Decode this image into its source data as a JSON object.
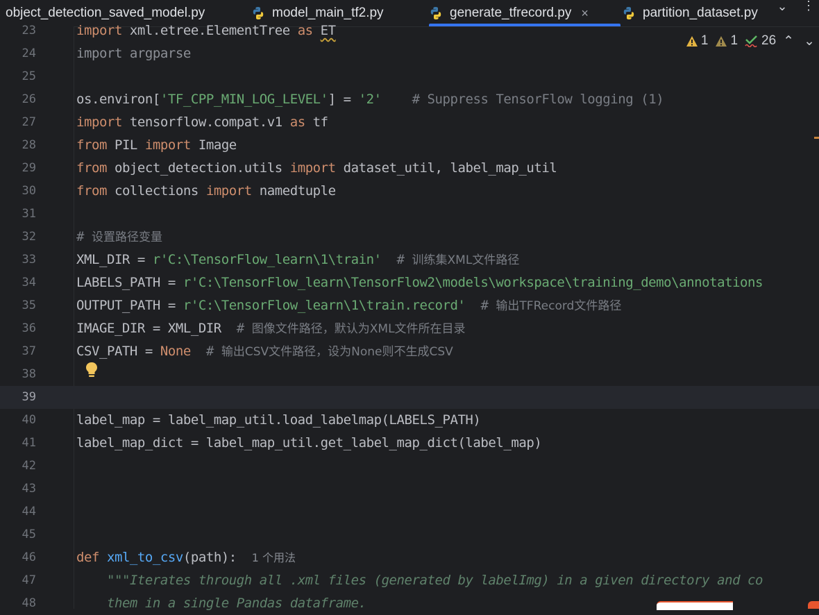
{
  "tabs": [
    {
      "label": "object_detection_saved_model.py",
      "icon": "python-file-icon",
      "active": false
    },
    {
      "label": "model_main_tf2.py",
      "icon": "python-file-icon",
      "active": false
    },
    {
      "label": "generate_tfrecord.py",
      "icon": "python-file-icon",
      "active": true
    },
    {
      "label": "partition_dataset.py",
      "icon": "python-file-icon",
      "active": false
    }
  ],
  "tab_close_glyph": "×",
  "tab_overflow_glyph": "⌄",
  "more_glyph": "⋮",
  "inspections": {
    "warnings": "1",
    "weak_warnings": "1",
    "typos": "26",
    "up_glyph": "⌃",
    "down_glyph": "⌄"
  },
  "current_line": "39",
  "editor": {
    "l23": {
      "n": "23",
      "t": [
        "import",
        " xml.etree.ElementTree ",
        "as",
        " ",
        "ET"
      ]
    },
    "l24": {
      "n": "24",
      "t": [
        "import argparse"
      ]
    },
    "l25": {
      "n": "25"
    },
    "l26": {
      "n": "26",
      "t": [
        "os.environ[",
        "'TF_CPP_MIN_LOG_LEVEL'",
        "] = ",
        "'2'",
        "    ",
        "# Suppress TensorFlow logging (1)"
      ]
    },
    "l27": {
      "n": "27",
      "t": [
        "import",
        " tensorflow.compat.v1 ",
        "as",
        " tf"
      ]
    },
    "l28": {
      "n": "28",
      "t": [
        "from",
        " PIL ",
        "import",
        " Image"
      ]
    },
    "l29": {
      "n": "29",
      "t": [
        "from",
        " object_detection.utils ",
        "import",
        " dataset_util, label_map_util"
      ]
    },
    "l30": {
      "n": "30",
      "t": [
        "from",
        " collections ",
        "import",
        " namedtuple"
      ]
    },
    "l31": {
      "n": "31"
    },
    "l32": {
      "n": "32",
      "t": [
        "# ",
        "设置路径变量"
      ]
    },
    "l33": {
      "n": "33",
      "t": [
        "XML_DIR = ",
        "r'C:\\TensorFlow_learn\\1\\train'",
        "  ",
        "# ",
        "训练集XML文件路径"
      ]
    },
    "l34": {
      "n": "34",
      "t": [
        "LABELS_PATH = ",
        "r'C:\\TensorFlow_learn\\TensorFlow2\\models\\workspace\\training_demo\\annotations"
      ]
    },
    "l35": {
      "n": "35",
      "t": [
        "OUTPUT_PATH = ",
        "r'C:\\TensorFlow_learn\\1\\train.record'",
        "  ",
        "# ",
        "输出TFRecord文件路径"
      ]
    },
    "l36": {
      "n": "36",
      "t": [
        "IMAGE_DIR = XML_DIR  ",
        "# ",
        "图像文件路径，默认为XML文件所在目录"
      ]
    },
    "l37": {
      "n": "37",
      "t": [
        "CSV_PATH = ",
        "None",
        "  ",
        "# ",
        "输出CSV文件路径，设为None则不生成CSV"
      ]
    },
    "l38": {
      "n": "38"
    },
    "l39": {
      "n": "39"
    },
    "l40": {
      "n": "40",
      "t": [
        "label_map = label_map_util.load_labelmap(LABELS_PATH)"
      ]
    },
    "l41": {
      "n": "41",
      "t": [
        "label_map_dict = label_map_util.get_label_map_dict(label_map)"
      ]
    },
    "l42": {
      "n": "42"
    },
    "l43": {
      "n": "43"
    },
    "l44": {
      "n": "44"
    },
    "l45": {
      "n": "45"
    },
    "l46": {
      "n": "46",
      "t": [
        "def",
        " ",
        "xml_to_csv",
        "(path):",
        "  ",
        "1 个用法"
      ]
    },
    "l47": {
      "n": "47",
      "t": [
        "    ",
        "\"\"\"Iterates through all .xml files (generated by labelImg) in a given directory and co"
      ]
    },
    "l48": {
      "n": "48",
      "t": [
        "    ",
        "them in a single Pandas dataframe."
      ]
    }
  }
}
